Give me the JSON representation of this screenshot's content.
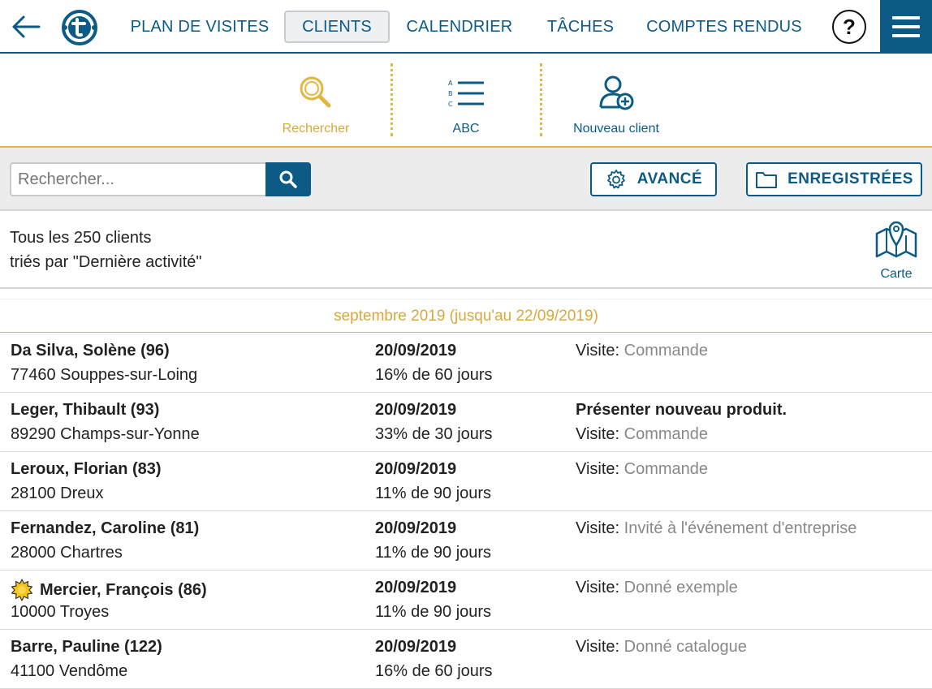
{
  "nav": {
    "items": [
      {
        "label": "PLAN DE VISITES"
      },
      {
        "label": "CLIENTS"
      },
      {
        "label": "CALENDRIER"
      },
      {
        "label": "TÂCHES"
      },
      {
        "label": "COMPTES RENDUS"
      }
    ],
    "active": "CLIENTS",
    "help_label": "?"
  },
  "toolbar": {
    "search_label": "Rechercher",
    "abc_label": "ABC",
    "new_client_label": "Nouveau client",
    "abc_letters": [
      "A",
      "B",
      "C"
    ]
  },
  "search": {
    "placeholder": "Rechercher...",
    "advanced_label": "AVANCÉ",
    "saved_label": "ENREGISTRÉES"
  },
  "summary": {
    "line1": "Tous les 250 clients",
    "line2": "triés par \"Dernière activité\"",
    "map_label": "Carte"
  },
  "list": {
    "group_header": "septembre 2019 (jusqu'au 22/09/2019)",
    "rows": [
      {
        "name": "Da Silva, Solène (96)",
        "city": "77460 Souppes-sur-Loing",
        "date": "20/09/2019",
        "pct": "16% de 60 jours",
        "note": "",
        "visit_prefix": "Visite:",
        "visit_value": "Commande"
      },
      {
        "name": "Leger, Thibault (93)",
        "city": "89290 Champs-sur-Yonne",
        "date": "20/09/2019",
        "pct": "33% de 30 jours",
        "note": "Présenter nouveau produit.",
        "visit_prefix": "Visite:",
        "visit_value": "Commande"
      },
      {
        "name": "Leroux, Florian (83)",
        "city": "28100 Dreux",
        "date": "20/09/2019",
        "pct": "11% de 90 jours",
        "note": "",
        "visit_prefix": "Visite:",
        "visit_value": "Commande"
      },
      {
        "name": "Fernandez, Caroline (81)",
        "city": "28000 Chartres",
        "date": "20/09/2019",
        "pct": "11% de 90 jours",
        "note": "",
        "visit_prefix": "Visite:",
        "visit_value": "Invité à l'événement d'entreprise"
      },
      {
        "name": "Mercier, François (86)",
        "city": "10000 Troyes",
        "date": "20/09/2019",
        "pct": "11% de 90 jours",
        "note": "",
        "visit_prefix": "Visite:",
        "visit_value": "Donné exemple",
        "starred": true
      },
      {
        "name": "Barre, Pauline (122)",
        "city": "41100 Vendôme",
        "date": "20/09/2019",
        "pct": "16% de 60 jours",
        "note": "",
        "visit_prefix": "Visite:",
        "visit_value": "Donné catalogue"
      }
    ]
  },
  "colors": {
    "brand": "#0c5b87",
    "accent": "#e2b63f",
    "muted_text": "#888888"
  }
}
